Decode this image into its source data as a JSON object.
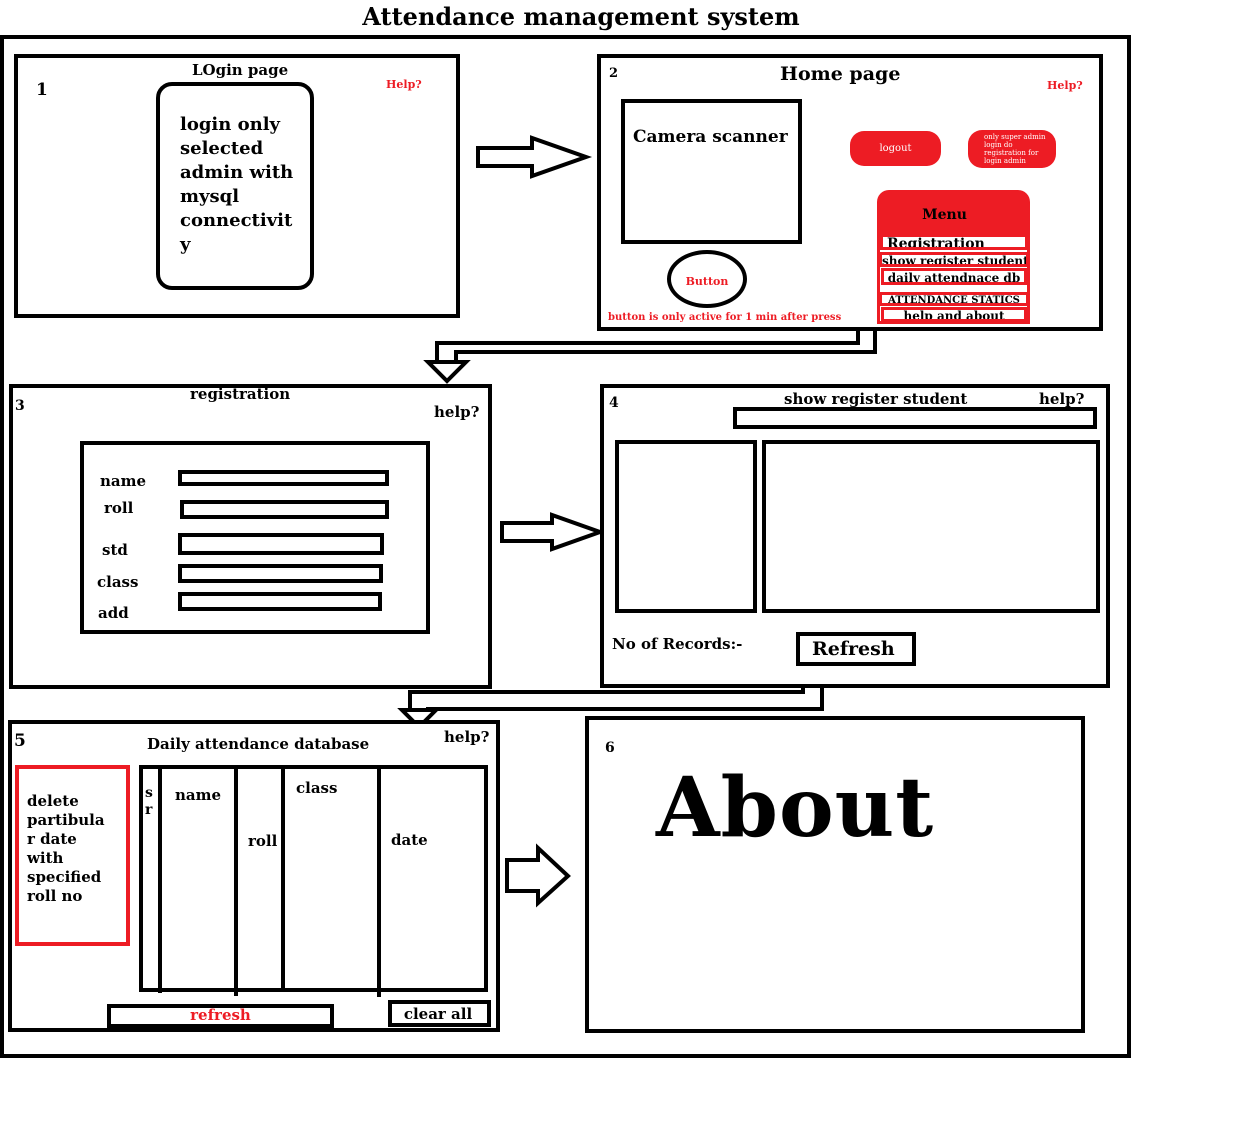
{
  "title": "Attendance management system",
  "login": {
    "num": "1",
    "title": "LOgin page",
    "help": "Help?",
    "desc_lines": [
      "login only",
      "selected",
      "admin with",
      "mysql",
      "connectivit",
      "y"
    ]
  },
  "home": {
    "num": "2",
    "title": "Home page",
    "help": "Help?",
    "camera": "Camera scanner",
    "button": "Button",
    "logout": "logout",
    "note_lines": [
      "only super admin",
      "login do",
      "registration for",
      "login admin"
    ],
    "menu_title": "Menu",
    "menu_items": [
      "Registration",
      "show register student",
      "daily attendnace db",
      "ATTENDANCE STATICS",
      "help and about"
    ],
    "footer_note": "button is only active for 1 min after press"
  },
  "registration": {
    "num": "3",
    "title": "registration",
    "help": "help?",
    "fields": [
      "name",
      "roll",
      "std",
      "class",
      "add"
    ]
  },
  "show_register": {
    "num": "4",
    "title": "show register student",
    "help": "help?",
    "records_label": "No of Records:-",
    "refresh": "Refresh"
  },
  "daily_db": {
    "num": "5",
    "title": "Daily attendance database",
    "help": "help?",
    "delete_lines": [
      "delete",
      "partibula",
      "r date",
      "with",
      "specified",
      "roll no"
    ],
    "sr_lines": [
      "s",
      "r"
    ],
    "columns": [
      "name",
      "roll",
      "class",
      "date"
    ],
    "refresh": "refresh",
    "clear": "clear all"
  },
  "about": {
    "num": "6",
    "title": "About"
  },
  "colors": {
    "accent": "#ed1c24",
    "ink": "#000000"
  }
}
